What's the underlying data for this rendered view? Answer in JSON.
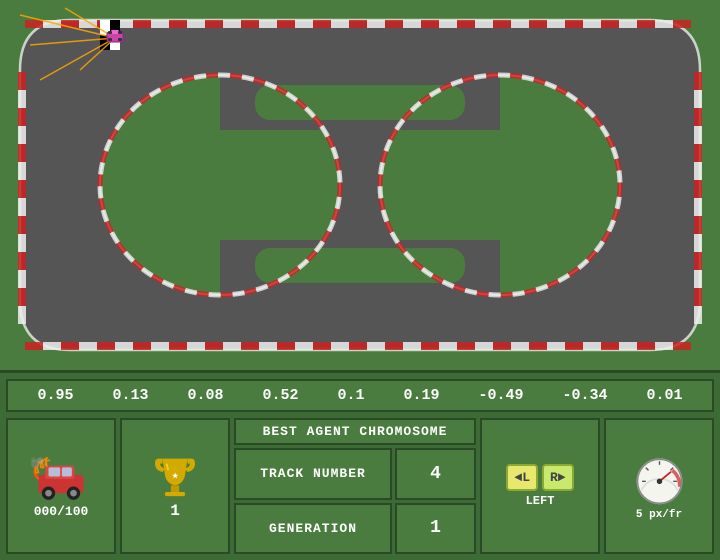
{
  "chromosome": {
    "values": [
      "0.95",
      "0.13",
      "0.08",
      "0.52",
      "0.1",
      "0.19",
      "-0.49",
      "-0.34",
      "0.01"
    ]
  },
  "panel": {
    "best_agent_label": "BEST AGENT CHROMOSOME",
    "track_number_label": "TRACK NUMBER",
    "track_number_value": "4",
    "generation_label": "GENERATION",
    "generation_value": "1",
    "score_value": "000/100",
    "trophy_value": "1",
    "direction_label": "LEFT",
    "speed_label": "5 px/fr",
    "left_arrow": "◄L",
    "right_arrow": "R►"
  },
  "colors": {
    "grass": "#4a7c3f",
    "panel_bg": "#3d6b35",
    "cell_bg": "#4a7c3f",
    "border": "#2a4a25",
    "text": "#ffffff",
    "track": "#555555",
    "curb_red": "#cc2222",
    "curb_white": "#eeeeee"
  }
}
